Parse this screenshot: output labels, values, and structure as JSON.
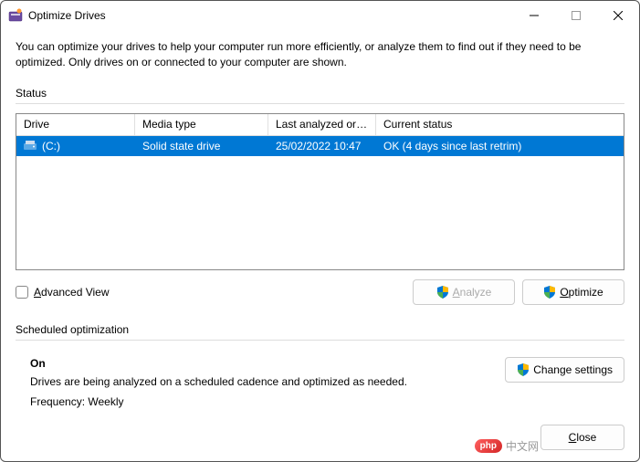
{
  "window": {
    "title": "Optimize Drives"
  },
  "description": "You can optimize your drives to help your computer run more efficiently, or analyze them to find out if they need to be optimized. Only drives on or connected to your computer are shown.",
  "status": {
    "label": "Status",
    "columns": {
      "drive": "Drive",
      "media": "Media type",
      "analyzed": "Last analyzed or o...",
      "status": "Current status"
    },
    "rows": [
      {
        "drive": "(C:)",
        "media": "Solid state drive",
        "analyzed": "25/02/2022 10:47",
        "status": "OK (4 days since last retrim)"
      }
    ]
  },
  "advanced_view": {
    "label_pre": "A",
    "label_rest": "dvanced View"
  },
  "buttons": {
    "analyze_pre": "A",
    "analyze_rest": "nalyze",
    "optimize_pre": "O",
    "optimize_rest": "ptimize",
    "change_settings": "Change settings",
    "close_pre": "C",
    "close_rest": "lose"
  },
  "scheduled": {
    "label": "Scheduled optimization",
    "status": "On",
    "description": "Drives are being analyzed on a scheduled cadence and optimized as needed.",
    "frequency": "Frequency: Weekly"
  },
  "watermark": {
    "badge": "php",
    "text": "中文网"
  }
}
